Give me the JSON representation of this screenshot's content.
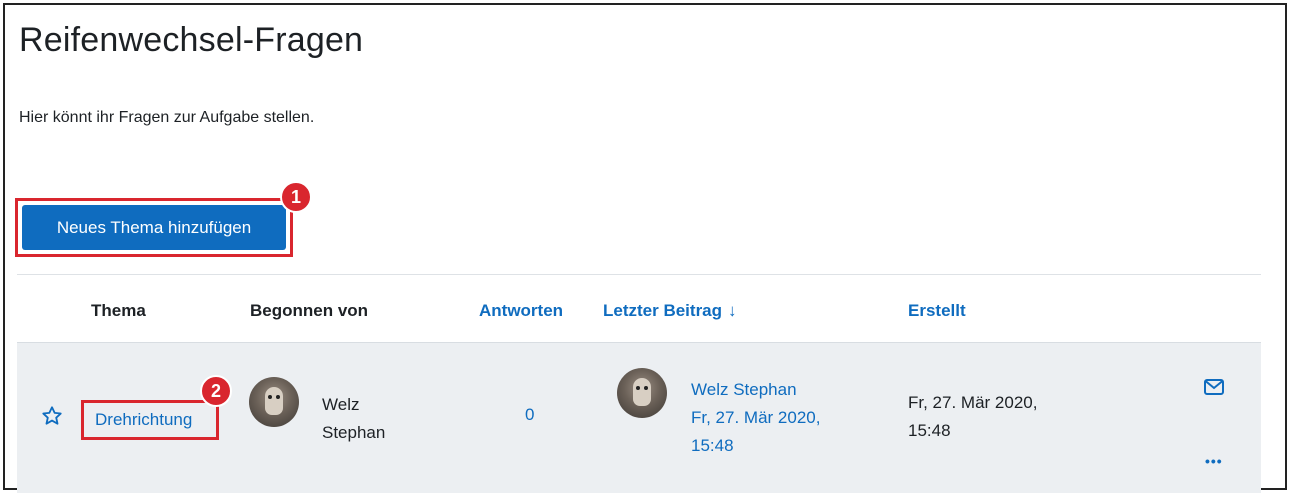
{
  "page": {
    "title": "Reifenwechsel-Fragen",
    "intro": "Hier könnt ihr Fragen zur Aufgabe stellen."
  },
  "actions": {
    "add_topic_label": "Neues Thema hinzufügen"
  },
  "markers": [
    "1",
    "2"
  ],
  "table": {
    "headers": {
      "topic": "Thema",
      "started_by": "Begonnen von",
      "replies": "Antworten",
      "last_post": "Letzter Beitrag",
      "created": "Erstellt"
    },
    "sort_indicator": "↓",
    "rows": [
      {
        "topic": "Drehrichtung",
        "author_first": "Welz",
        "author_last": "Stephan",
        "replies": "0",
        "last_post_author": "Welz Stephan",
        "last_post_date": "Fr, 27. Mär 2020,",
        "last_post_time": "15:48",
        "created_date": "Fr, 27. Mär 2020,",
        "created_time": "15:48"
      }
    ]
  },
  "icons": {
    "star": "star-outline-icon",
    "mail": "envelope-icon",
    "more": "ellipsis-icon"
  },
  "colors": {
    "primary": "#0f6cbf",
    "highlight": "#d9262e",
    "row_bg": "#eceff2"
  }
}
